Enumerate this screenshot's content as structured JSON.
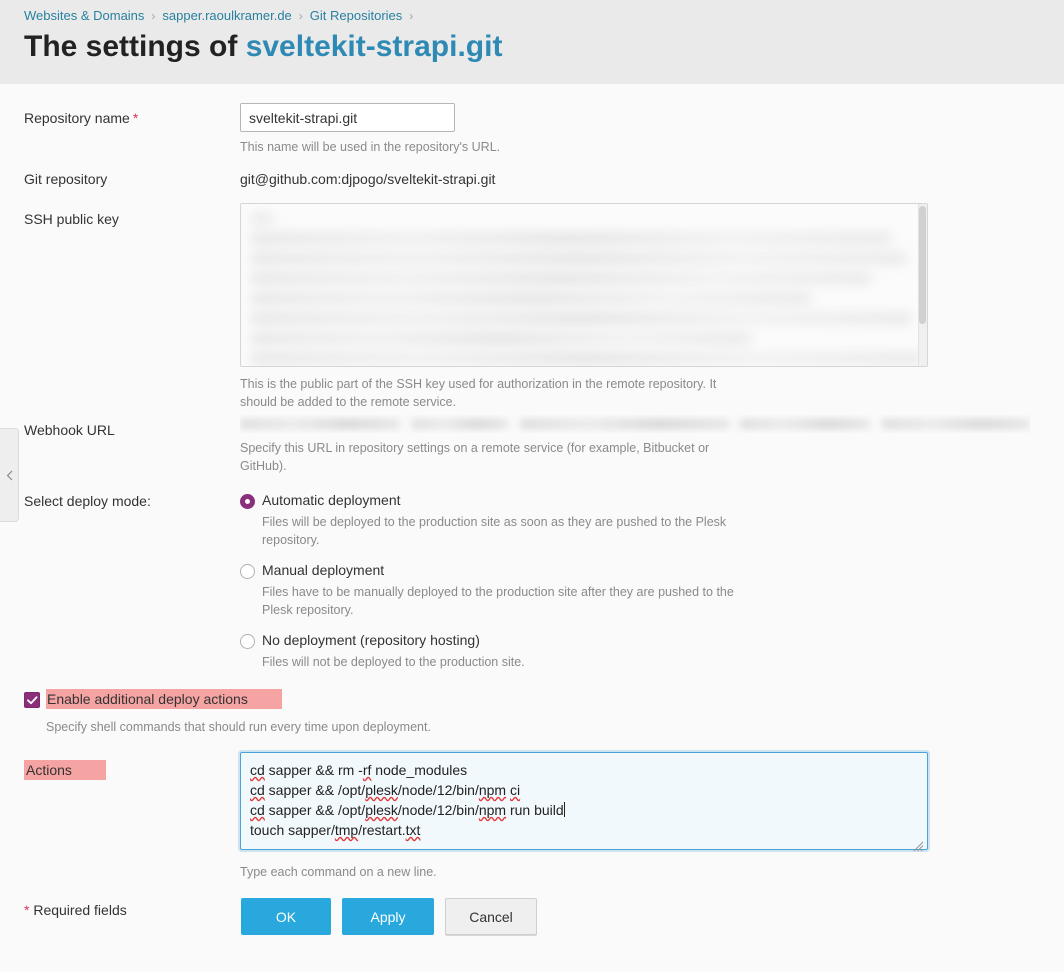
{
  "header": {
    "breadcrumb": [
      {
        "label": "Websites & Domains",
        "sep": "›"
      },
      {
        "label": "sapper.raoulkramer.de",
        "sep": "›"
      },
      {
        "label": "Git Repositories",
        "sep": "›"
      }
    ],
    "title_prefix": "The settings of ",
    "title_accent": "sveltekit-strapi.git"
  },
  "sidebar": {
    "collapse_icon": "chevron-left-icon"
  },
  "form": {
    "repository_name": {
      "label": "Repository name",
      "required_marker": "*",
      "value": "sveltekit-strapi.git",
      "hint": "This name will be used in the repository's URL."
    },
    "git_repository": {
      "label": "Git repository",
      "value": "git@github.com:djpogo/sveltekit-strapi.git"
    },
    "ssh_public_key": {
      "label": "SSH public key",
      "value": "",
      "hint": "This is the public part of the SSH key used for authorization in the remote repository. It should be added to the remote service."
    },
    "webhook_url": {
      "label": "Webhook URL",
      "value": "",
      "hint": "Specify this URL in repository settings on a remote service (for example, Bitbucket or GitHub)."
    },
    "deploy_mode": {
      "label": "Select deploy mode:",
      "selected": "automatic",
      "options": [
        {
          "id": "automatic",
          "label": "Automatic deployment",
          "desc": "Files will be deployed to the production site as soon as they are pushed to the Plesk repository.",
          "checked": true
        },
        {
          "id": "manual",
          "label": "Manual deployment",
          "desc": "Files have to be manually deployed to the production site after they are pushed to the Plesk repository.",
          "checked": false
        },
        {
          "id": "none",
          "label": "No deployment (repository hosting)",
          "desc": "Files will not be deployed to the production site.",
          "checked": false
        }
      ]
    },
    "additional_actions": {
      "checkbox_label": "Enable additional deploy actions",
      "checked": true,
      "hint": "Specify shell commands that should run every time upon deployment.",
      "highlight_color": "#f6a3a3"
    },
    "actions": {
      "label": "Actions",
      "value": "cd sapper && rm -rf node_modules\ncd sapper && /opt/plesk/node/12/bin/npm ci\ncd sapper && /opt/plesk/node/12/bin/npm run build\ntouch sapper/tmp/restart.txt",
      "lines": [
        "cd sapper && rm -rf node_modules",
        "cd sapper && /opt/plesk/node/12/bin/npm ci",
        "cd sapper && /opt/plesk/node/12/bin/npm run build",
        "touch sapper/tmp/restart.txt"
      ],
      "hint": "Type each command on a new line."
    }
  },
  "footer": {
    "required_star": "*",
    "required_text": " Required fields",
    "ok_label": "OK",
    "apply_label": "Apply",
    "cancel_label": "Cancel"
  },
  "colors": {
    "accent_blue": "#28a8dd",
    "link_blue": "#2e8ab4",
    "control_purple": "#8b2f7b",
    "required_red": "#d9355b",
    "highlight_pink": "#f6a3a3",
    "header_bg": "#eaeaea",
    "page_bg": "#fafafa"
  }
}
